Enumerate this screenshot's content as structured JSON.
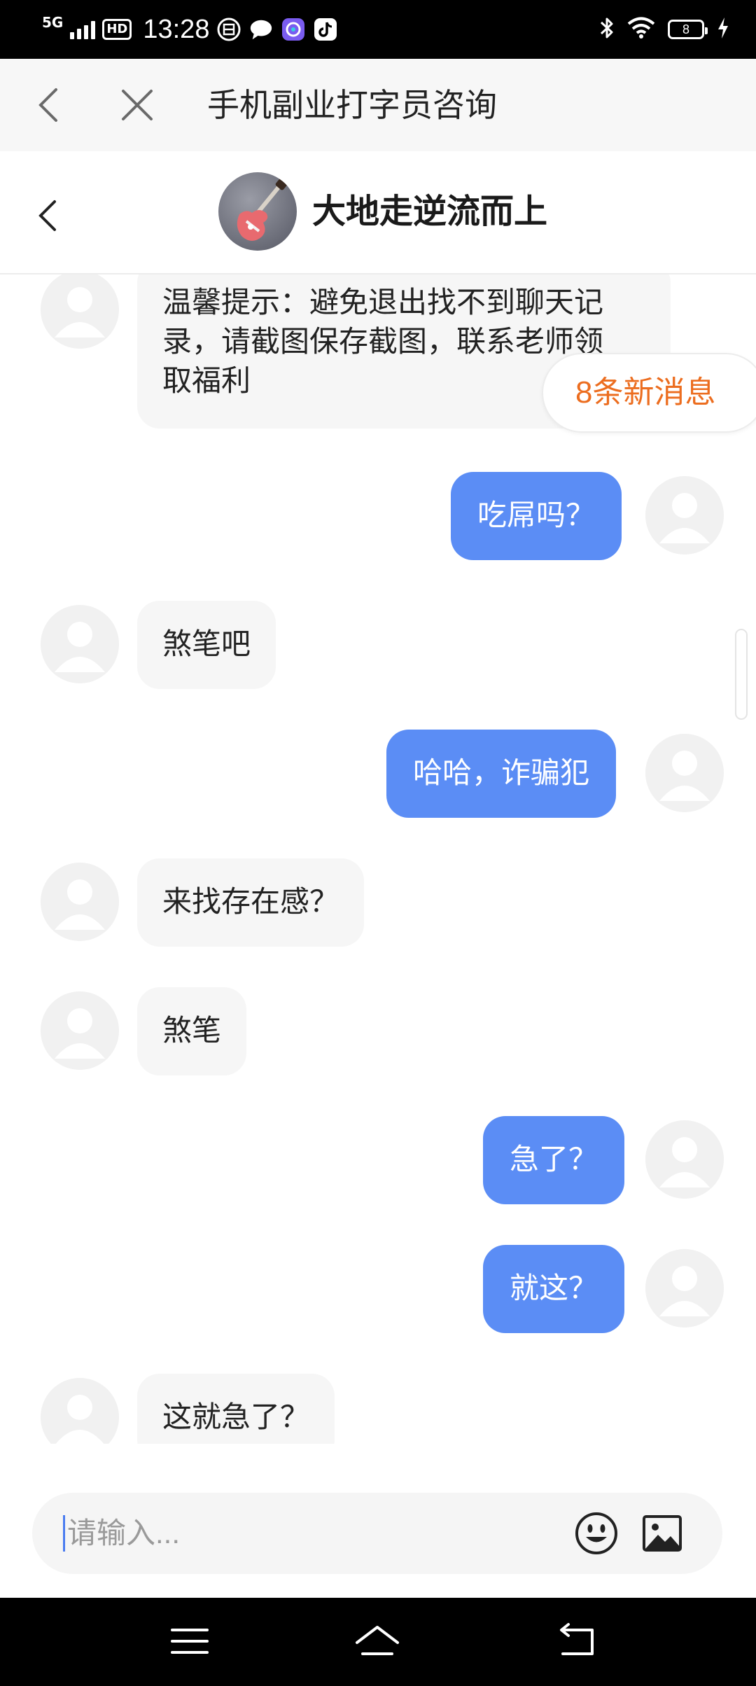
{
  "status_bar": {
    "network": "5G",
    "hd": "HD",
    "time": "13:28",
    "battery": "8"
  },
  "browser": {
    "title": "手机副业打字员咨询"
  },
  "chat": {
    "contact_name": "大地走逆流而上"
  },
  "new_messages_badge": "8条新消息",
  "messages": [
    {
      "side": "in",
      "text_lines": [
        "温馨提示：避免退出找不到聊天记",
        "录，请截图保存截图，联系老师领",
        "取福利"
      ]
    },
    {
      "side": "out",
      "text": "吃屌吗？"
    },
    {
      "side": "in",
      "text": "煞笔吧"
    },
    {
      "side": "out",
      "text": "哈哈，诈骗犯"
    },
    {
      "side": "in",
      "text": "来找存在感？"
    },
    {
      "side": "in",
      "text": "煞笔"
    },
    {
      "side": "out",
      "text": "急了？"
    },
    {
      "side": "out",
      "text": "就这？"
    },
    {
      "side": "in",
      "text": "这就急了？"
    }
  ],
  "input": {
    "placeholder": "请输入..."
  },
  "colors": {
    "outgoing_bubble": "#5b8df5",
    "incoming_bubble": "#f6f6f6",
    "badge_text": "#ec6d1f",
    "caret": "#4a7cf0"
  },
  "icons": [
    "chevron-left-icon",
    "close-icon",
    "emoji-icon",
    "image-icon",
    "menu-icon",
    "home-icon",
    "back-icon",
    "bluetooth-icon",
    "wifi-icon",
    "charging-icon"
  ]
}
